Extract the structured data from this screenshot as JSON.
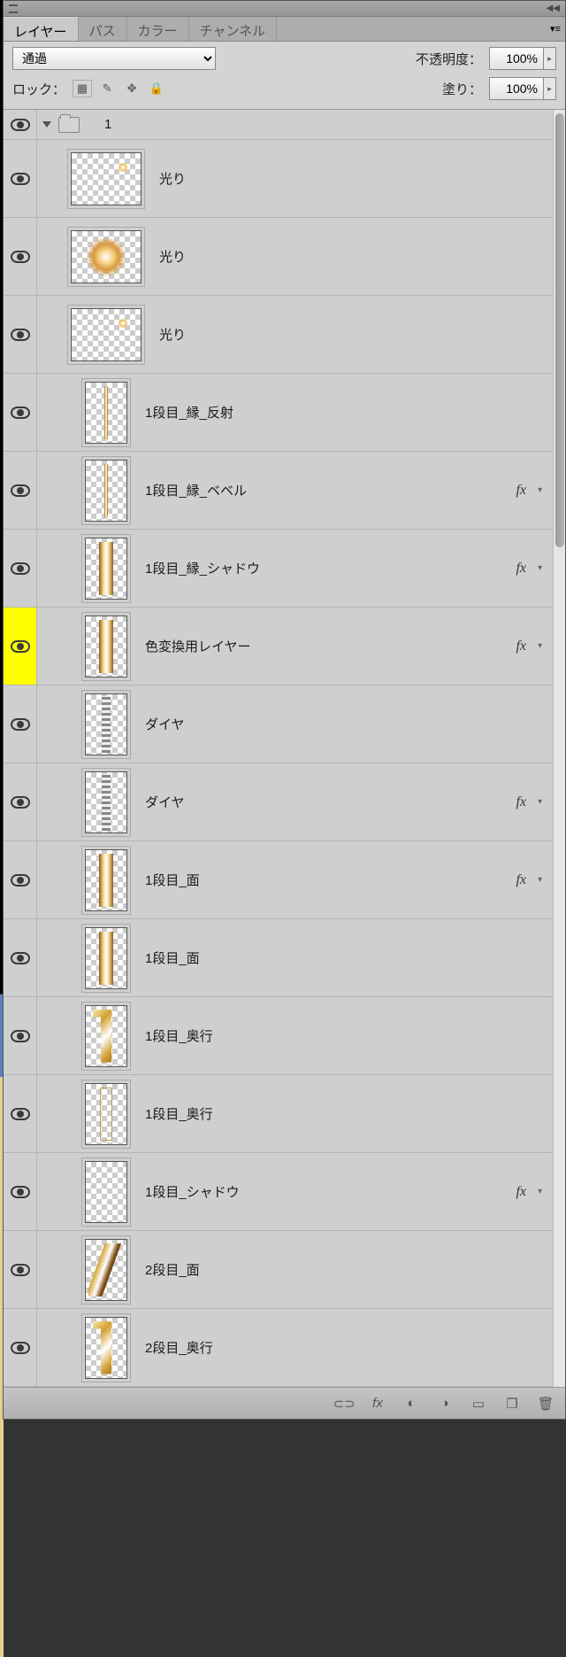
{
  "tabs": {
    "layers": "レイヤー",
    "paths": "パス",
    "color": "カラー",
    "channels": "チャンネル"
  },
  "options": {
    "blend_mode": "通過",
    "opacity_label": "不透明度：",
    "opacity_value": "100%",
    "lock_label": "ロック：",
    "fill_label": "塗り：",
    "fill_value": "100%"
  },
  "group": {
    "name": "1"
  },
  "layers": [
    {
      "name": "光り",
      "thumb": "wide",
      "art": "glow-dot",
      "fx": false,
      "highlight": false
    },
    {
      "name": "光り",
      "thumb": "wide",
      "art": "glow-big",
      "fx": false,
      "highlight": false
    },
    {
      "name": "光り",
      "thumb": "wide",
      "art": "glow-dot",
      "fx": false,
      "highlight": false
    },
    {
      "name": "1段目_縁_反射",
      "thumb": "tall",
      "art": "thin",
      "fx": false,
      "highlight": false
    },
    {
      "name": "1段目_縁_ベベル",
      "thumb": "tall",
      "art": "thin",
      "fx": true,
      "highlight": false
    },
    {
      "name": "1段目_縁_シャドウ",
      "thumb": "tall",
      "art": "gold-bar",
      "fx": true,
      "highlight": false
    },
    {
      "name": "色変換用レイヤー",
      "thumb": "tall",
      "art": "gold-bar",
      "fx": true,
      "highlight": true
    },
    {
      "name": "ダイヤ",
      "thumb": "tall",
      "art": "diamond-bar",
      "fx": false,
      "highlight": false
    },
    {
      "name": "ダイヤ",
      "thumb": "tall",
      "art": "diamond-bar",
      "fx": true,
      "highlight": false
    },
    {
      "name": "1段目_面",
      "thumb": "tall",
      "art": "gold-bar",
      "fx": true,
      "highlight": false
    },
    {
      "name": "1段目_面",
      "thumb": "tall",
      "art": "gold-bar",
      "fx": false,
      "highlight": false
    },
    {
      "name": "1段目_奥行",
      "thumb": "tall",
      "art": "gold-digit",
      "fx": false,
      "highlight": false
    },
    {
      "name": "1段目_奥行",
      "thumb": "tall",
      "art": "outline",
      "fx": false,
      "highlight": false
    },
    {
      "name": "1段目_シャドウ",
      "thumb": "tall",
      "art": "",
      "fx": true,
      "highlight": false
    },
    {
      "name": "2段目_面",
      "thumb": "tall",
      "art": "gold-slash",
      "fx": false,
      "highlight": false
    },
    {
      "name": "2段目_奥行",
      "thumb": "tall",
      "art": "gold-digit",
      "fx": false,
      "highlight": false
    }
  ],
  "fx_label": "fx",
  "footer_icons": [
    "link",
    "fx",
    "mask",
    "adjust",
    "group",
    "new",
    "trash"
  ]
}
